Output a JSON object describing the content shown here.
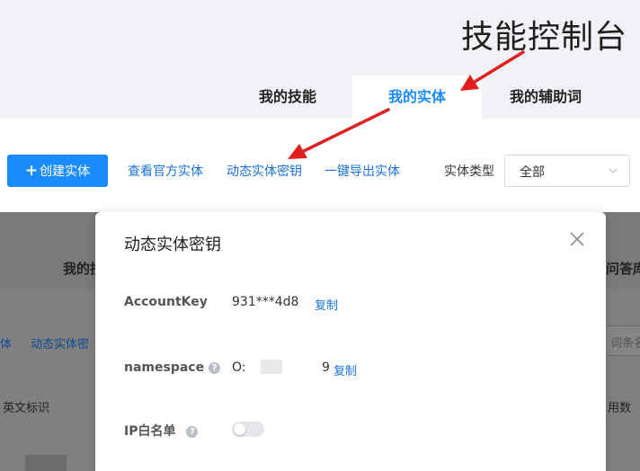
{
  "header": {
    "title": "技能控制台",
    "tabs": [
      {
        "label": "我的技能"
      },
      {
        "label": "我的实体"
      },
      {
        "label": "我的辅助词"
      }
    ]
  },
  "toolbar": {
    "create_label": "创建实体",
    "create_icon": "plus-icon",
    "view_official": "查看官方实体",
    "dynamic_key": "动态实体密钥",
    "export": "一键导出实体",
    "type_label": "实体类型",
    "type_value": "全部"
  },
  "background": {
    "tab_left": "我的技",
    "tab_right": "问答库",
    "link_left": "体",
    "link_dynamic": "动态实体密",
    "search_placeholder": "词条名",
    "col_english": "英文标识",
    "col_count": "用数"
  },
  "modal": {
    "title": "动态实体密钥",
    "account_label": "AccountKey",
    "account_value": "931***4d8",
    "copy_label": "复制",
    "namespace_label": "namespace",
    "namespace_prefix": "O:",
    "namespace_suffix": "9",
    "ip_label": "IP白名单",
    "ip_enabled": false
  },
  "colors": {
    "primary": "#1a8cff",
    "link": "#1a73d9",
    "header_bg": "#f0f2f5",
    "overlay": "#7a7a7a",
    "annotation_arrow": "#e02020"
  }
}
